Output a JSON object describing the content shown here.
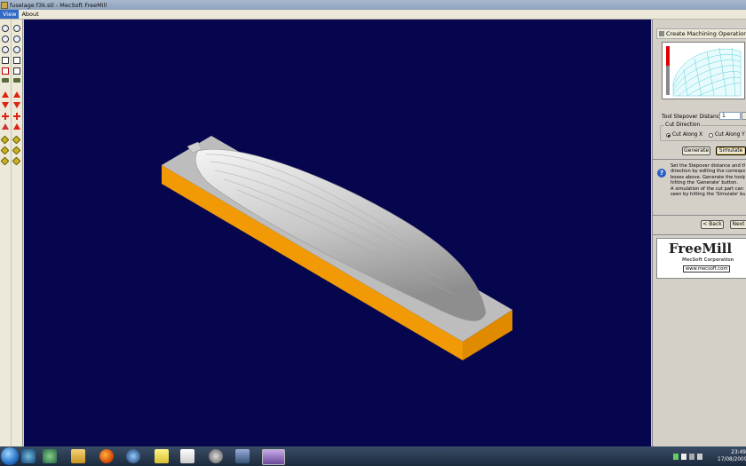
{
  "window": {
    "title": "fuselage f3k.stl - MecSoft FreeMill"
  },
  "menu": [
    "View",
    "About"
  ],
  "toolbar_left": [
    "zoom-in-icon",
    "zoom-out-icon",
    "zoom-window-icon",
    "zoom-extents-icon",
    "view-box-icon",
    "view-box-red-icon",
    "stock-view-icon",
    "arrow-up-icon",
    "arrow-down-icon",
    "pan-icon",
    "rotate-icon",
    "shade-icon",
    "shade-icon",
    "shade-icon"
  ],
  "panel": {
    "header": "Create Machining Operation...",
    "stepover_label": "Tool Stepover Distance:",
    "stepover_value": "1",
    "cut_direction_label": "Cut Direction",
    "cut_along_x": "Cut Along X",
    "cut_along_y": "Cut Along Y",
    "selected_direction": "x",
    "generate_button": "Generate",
    "simulate_button": "Simulate",
    "help_text": "Set the Stepover distance and the C\ndirection by editing the correspondin\nboxes above. Generate the toolpath\nhitting the 'Generate' button.\nA simulation of the cut part can be\nseen by hitting the 'Simulate' button.",
    "back_button": "< Back",
    "next_button": "Next >",
    "logo_text": "FreeMill",
    "logo_company": "MecSoft Corporation",
    "logo_url": "www.mecsoft.com"
  },
  "colors": {
    "viewport_bg": "#06064e",
    "stock": "#f19a06",
    "part": "#b9b9b9",
    "preview_wire": "#58d0d8"
  },
  "taskbar": {
    "apps": [
      "windows-live-icon",
      "people-icon",
      "file-explorer-icon",
      "firefox-icon",
      "media-player-icon",
      "sticky-notes-icon",
      "notepad-icon",
      "cnc-app-icon",
      "steam-icon",
      "remote-desktop-icon",
      "freemill-icon"
    ],
    "clock_time": "23:49",
    "clock_date": "17/08/2009"
  }
}
